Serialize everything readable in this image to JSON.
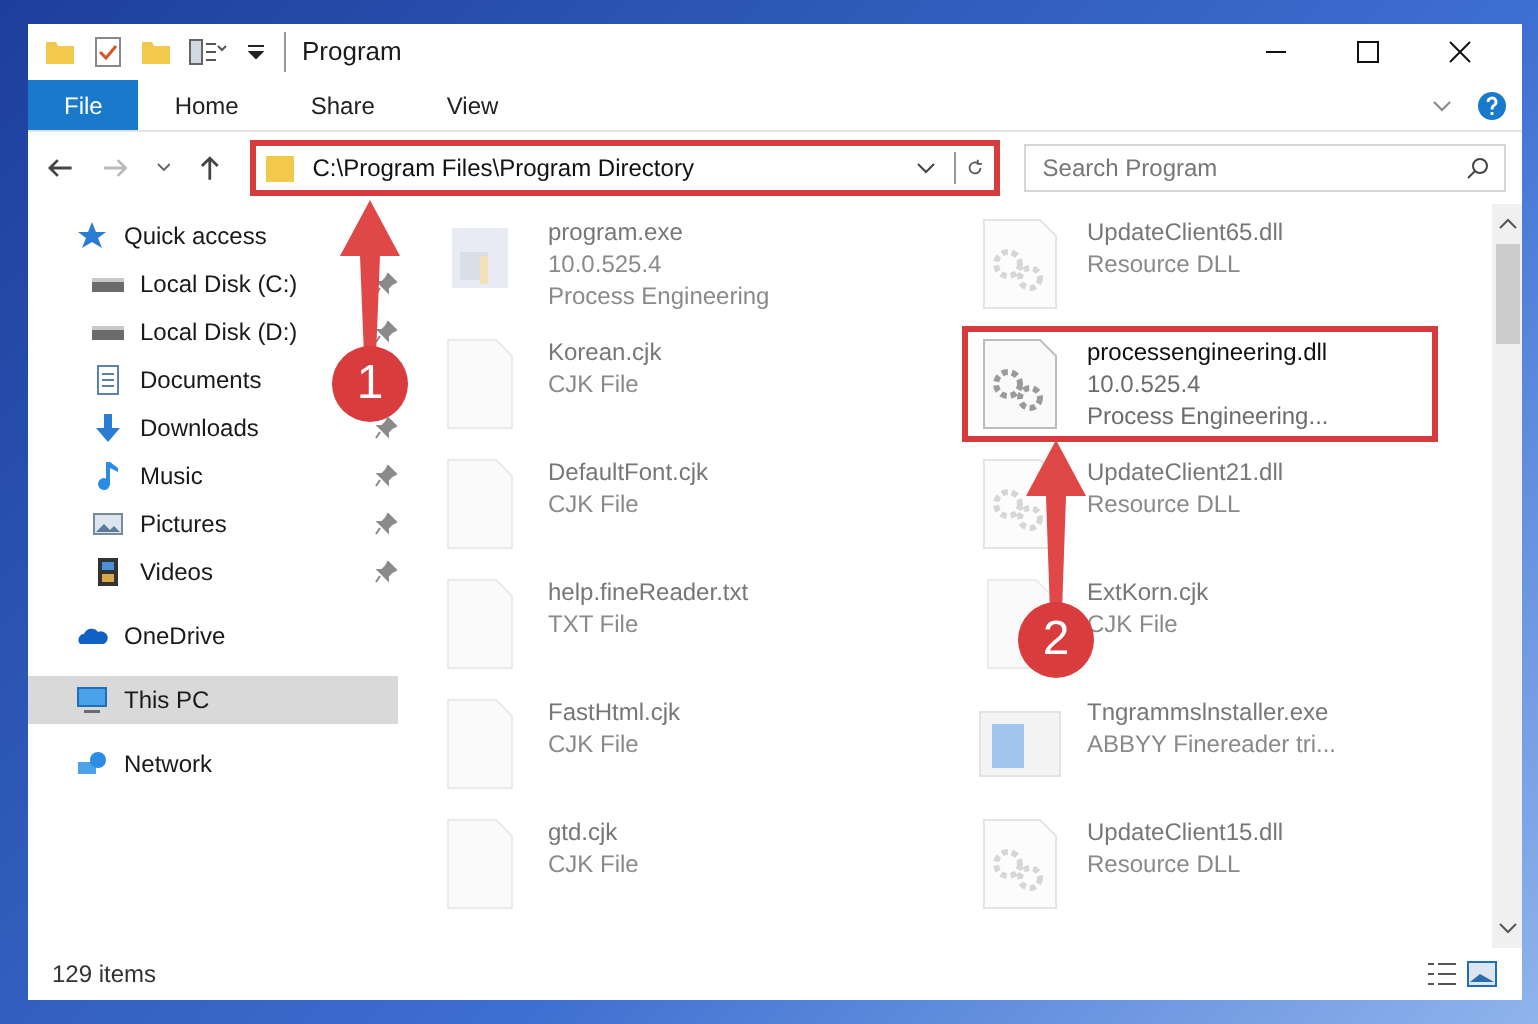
{
  "window": {
    "title": "Program"
  },
  "ribbon_tabs": [
    {
      "label": "File",
      "selected": true
    },
    {
      "label": "Home",
      "selected": false
    },
    {
      "label": "Share",
      "selected": false
    },
    {
      "label": "View",
      "selected": false
    }
  ],
  "address": {
    "path": "C:\\Program Files\\Program Directory"
  },
  "search": {
    "placeholder": "Search Program"
  },
  "sidebar": {
    "items": [
      {
        "label": "Quick access",
        "kind": "star",
        "pinned": false,
        "selected": false,
        "children": [
          {
            "label": "Local Disk (C:)",
            "kind": "drive",
            "pinned": true,
            "selected": false
          },
          {
            "label": "Local Disk (D:)",
            "kind": "drive",
            "pinned": true,
            "selected": false
          },
          {
            "label": "Documents",
            "kind": "docs",
            "pinned": false,
            "selected": false
          },
          {
            "label": "Downloads",
            "kind": "download",
            "pinned": true,
            "selected": false
          },
          {
            "label": "Music",
            "kind": "music",
            "pinned": true,
            "selected": false
          },
          {
            "label": "Pictures",
            "kind": "pictures",
            "pinned": true,
            "selected": false
          },
          {
            "label": "Videos",
            "kind": "videos",
            "pinned": true,
            "selected": false
          }
        ]
      },
      {
        "label": "OneDrive",
        "kind": "cloud",
        "pinned": false,
        "selected": false
      },
      {
        "label": "This PC",
        "kind": "pc",
        "pinned": false,
        "selected": true
      },
      {
        "label": "Network",
        "kind": "network",
        "pinned": false,
        "selected": false
      }
    ]
  },
  "files": [
    {
      "name": "program.exe",
      "lines": [
        "10.0.525.4",
        "Process Engineering"
      ],
      "kind": "exe",
      "highlighted": false
    },
    {
      "name": "UpdateClient65.dll",
      "lines": [
        "Resource DLL"
      ],
      "kind": "dll",
      "highlighted": false
    },
    {
      "name": "Korean.cjk",
      "lines": [
        "CJK File"
      ],
      "kind": "doc",
      "highlighted": false
    },
    {
      "name": "processengineering.dll",
      "lines": [
        "10.0.525.4",
        "Process Engineering..."
      ],
      "kind": "dll",
      "highlighted": true
    },
    {
      "name": "DefaultFont.cjk",
      "lines": [
        "CJK File"
      ],
      "kind": "doc",
      "highlighted": false
    },
    {
      "name": "UpdateClient21.dll",
      "lines": [
        "Resource DLL"
      ],
      "kind": "dll",
      "highlighted": false
    },
    {
      "name": "help.fineReader.txt",
      "lines": [
        "TXT File"
      ],
      "kind": "doc",
      "highlighted": false
    },
    {
      "name": "ExtKorn.cjk",
      "lines": [
        "CJK File"
      ],
      "kind": "doc",
      "highlighted": false
    },
    {
      "name": "FastHtml.cjk",
      "lines": [
        "CJK File"
      ],
      "kind": "doc",
      "highlighted": false
    },
    {
      "name": "Tngrammslnstaller.exe",
      "lines": [
        "ABBYY Finereader tri..."
      ],
      "kind": "installer",
      "highlighted": false
    },
    {
      "name": "gtd.cjk",
      "lines": [
        "CJK File"
      ],
      "kind": "doc",
      "highlighted": false
    },
    {
      "name": "UpdateClient15.dll",
      "lines": [
        "Resource DLL"
      ],
      "kind": "dll",
      "highlighted": false
    }
  ],
  "status_bar": {
    "count": "129 items"
  },
  "annotations": [
    {
      "number": "1"
    },
    {
      "number": "2"
    }
  ]
}
